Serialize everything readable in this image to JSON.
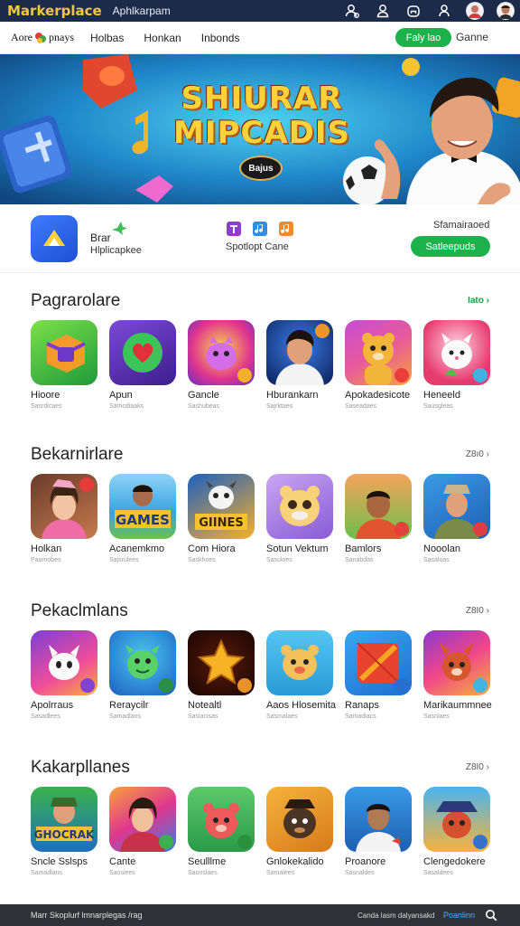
{
  "topbar": {
    "brand": "Markerplace",
    "subtitle": "Aphlkarpam",
    "icons": [
      "users-icon",
      "person-add-icon",
      "home-icon",
      "profile-icon",
      "avatar",
      "avatar"
    ]
  },
  "nav": {
    "logo_left": "Aore",
    "logo_right": "pnays",
    "links": [
      "Holbas",
      "Honkan",
      "Inbonds"
    ],
    "play_button": "Faly lao",
    "game_link": "Ganne"
  },
  "hero": {
    "title_line1": "SHIURAR",
    "title_line2": "MIPCADIS",
    "badge": "Bajus"
  },
  "featured": {
    "app_name": "Brar",
    "app_sub": "Hlplicapkee",
    "mid_label": "Spotlopt Cane",
    "right_label": "Sfamairaoed",
    "button": "Satleepuds"
  },
  "sections": [
    {
      "title": "Pagrarolare",
      "more": "Iato",
      "apps": [
        {
          "name": "Hioore",
          "sub": "Sasrdicaes"
        },
        {
          "name": "Apun",
          "sub": "Samcdiaaks"
        },
        {
          "name": "Gancle",
          "sub": "Sashubeas"
        },
        {
          "name": "Hburankarn",
          "sub": "Sajrktaes"
        },
        {
          "name": "Apokadesicote",
          "sub": "Saseadaes"
        },
        {
          "name": "Heneeld",
          "sub": "Sausgleas"
        }
      ]
    },
    {
      "title": "Bekarnirlare",
      "more": "Z8ı0",
      "apps": [
        {
          "name": "Holkan",
          "sub": "Paamobes"
        },
        {
          "name": "Acanemkmo",
          "sub": "Sajsrulees"
        },
        {
          "name": "Com Hiora",
          "sub": "Saskhoes"
        },
        {
          "name": "Sotun Vektum",
          "sub": "Sasuloes"
        },
        {
          "name": "Bamlors",
          "sub": "Sanabdas"
        },
        {
          "name": "Nooolan",
          "sub": "Sasaloas"
        }
      ]
    },
    {
      "title": "Pekaclmlans",
      "more": "Z8I0",
      "apps": [
        {
          "name": "Apolrraus",
          "sub": "Sasadlees"
        },
        {
          "name": "Reraycilr",
          "sub": "Samadlans"
        },
        {
          "name": "Notealtl",
          "sub": "Saslacisas"
        },
        {
          "name": "Aaos Hlosemita",
          "sub": "Sasmalaes"
        },
        {
          "name": "Ranaps",
          "sub": "Samadiacs"
        },
        {
          "name": "Marikaummnee",
          "sub": "Sasnlaes"
        }
      ]
    },
    {
      "title": "Kakarpllanes",
      "more": "Z8I0",
      "apps": [
        {
          "name": "Sncle Sslsps",
          "sub": "Samadlans"
        },
        {
          "name": "Cante",
          "sub": "Saoslees"
        },
        {
          "name": "Seulllme",
          "sub": "Saonslaes"
        },
        {
          "name": "Gnlokekalido",
          "sub": "Samalees"
        },
        {
          "name": "Proanore",
          "sub": "Sasnaldes"
        },
        {
          "name": "Clengedokere",
          "sub": "Sasaldees"
        }
      ]
    }
  ],
  "footer": {
    "left": "Marr Skoplurf lmnarplegas /rag",
    "mid": "Canda lasm dalyansakd",
    "link": "Poanlinn",
    "search_icon": "search-icon"
  },
  "colors": {
    "topbar": "#1d2b4a",
    "brand": "#f5c542",
    "accent_green": "#1db14b",
    "footer": "#2f3236"
  }
}
